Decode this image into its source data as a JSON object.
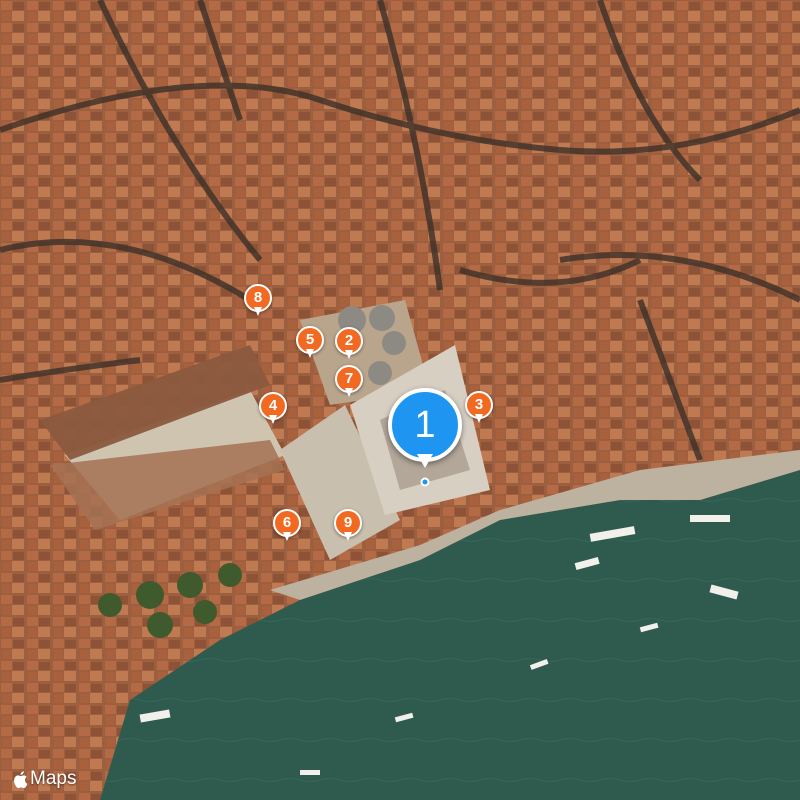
{
  "map": {
    "type": "satellite",
    "attribution": {
      "brand": "Maps"
    }
  },
  "pins": [
    {
      "label": "1",
      "color": "#1e95f0",
      "style": "large"
    },
    {
      "label": "2",
      "color": "#f26a22"
    },
    {
      "label": "3",
      "color": "#f26a22"
    },
    {
      "label": "4",
      "color": "#f26a22"
    },
    {
      "label": "5",
      "color": "#f26a22"
    },
    {
      "label": "6",
      "color": "#f26a22"
    },
    {
      "label": "7",
      "color": "#f26a22"
    },
    {
      "label": "8",
      "color": "#f26a22"
    },
    {
      "label": "9",
      "color": "#f26a22"
    }
  ],
  "colors": {
    "water": "#2f5b4f",
    "roofs": "#a5633f",
    "piazza": "#c9bfae",
    "pin_orange": "#f26a22",
    "pin_blue": "#1e95f0"
  },
  "icons": {
    "attribution_logo": "apple-logo-icon"
  }
}
